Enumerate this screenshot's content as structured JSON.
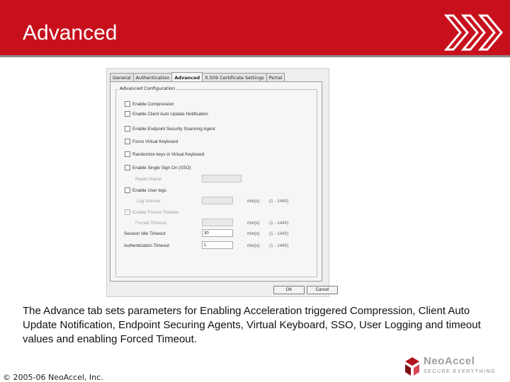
{
  "slide": {
    "title": "Advanced"
  },
  "dialog": {
    "tabs": [
      "General",
      "Authentication",
      "Advanced",
      "X.509 Certificate Settings",
      "Portal"
    ],
    "group_title": "Advanced Configuration",
    "checkboxes": [
      {
        "label": "Enable Compression",
        "enabled": true
      },
      {
        "label": "Enable Client Auto Update Notification",
        "enabled": true
      },
      {
        "label": "Enable Endpoint Security Scanning Agent",
        "enabled": true
      },
      {
        "label": "Force Virtual Keyboard",
        "enabled": true
      },
      {
        "label": "Randomize keys in Virtual Keyboard",
        "enabled": true
      },
      {
        "label": "Enable Single Sign On (SSO)",
        "enabled": true
      },
      {
        "label": "Enable User logs",
        "enabled": true
      },
      {
        "label": "Enable Forced Timeout",
        "enabled": false
      }
    ],
    "realm_label": "Realm Name",
    "log_interval_label": "Log Interval",
    "forced_timeout_label": "Forced Timeout",
    "session_idle_label": "Session Idle Timeout",
    "session_idle_value": "30",
    "auth_timeout_label": "Authentication Timeout",
    "auth_timeout_value": "1",
    "unit": "min(s)",
    "range": "(1 - 1440)",
    "ok_label": "OK",
    "cancel_label": "Cancel"
  },
  "caption": "The Advance tab sets parameters for Enabling Acceleration triggered Compression, Client Auto Update Notification, Endpoint Securing Agents, Virtual Keyboard, SSO, User Logging and timeout values and enabling Forced Timeout.",
  "footer": {
    "copyright": "© 2005-06 NeoAccel, Inc.",
    "logo_name": "NeoAccel",
    "logo_tagline": "SECURE EVERYTHING"
  },
  "colors": {
    "banner": "#c8101d",
    "logo_mark": "#b0121f"
  }
}
